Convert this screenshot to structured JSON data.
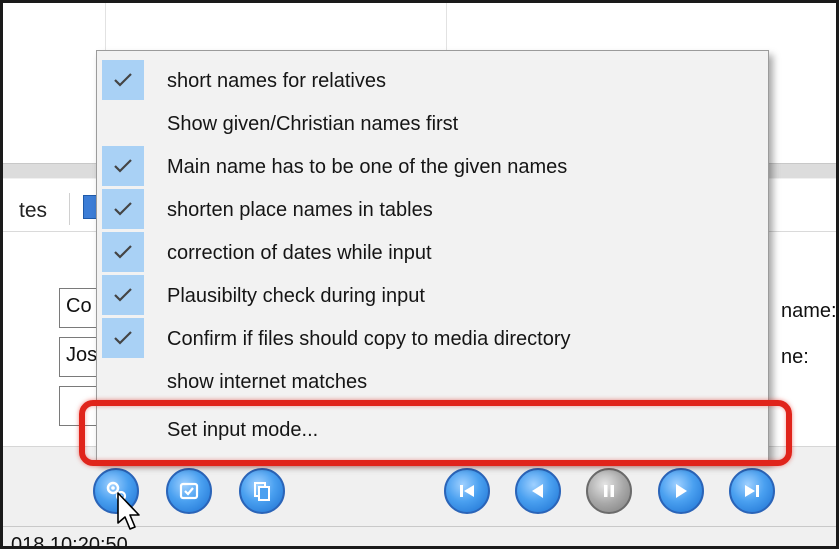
{
  "tab": {
    "label": "tes"
  },
  "form": {
    "field1": "Co",
    "field2": "Jos",
    "field3": "",
    "label1": "name:",
    "label2": "ne:"
  },
  "status": {
    "datetime": "018  10:20:50"
  },
  "menu": {
    "items": [
      {
        "label": "short names for relatives",
        "checked": true
      },
      {
        "label": "Show given/Christian names first",
        "checked": false
      },
      {
        "label": "Main name has to be one of the given names",
        "checked": true
      },
      {
        "label": "shorten place names in tables",
        "checked": true
      },
      {
        "label": "correction of dates while input",
        "checked": true
      },
      {
        "label": "Plausibilty check during input",
        "checked": true
      },
      {
        "label": "Confirm if files should copy to media directory",
        "checked": true
      },
      {
        "label": "show internet matches",
        "checked": false
      },
      {
        "label": "Set input mode...",
        "checked": false
      }
    ]
  },
  "toolbar": {
    "buttons": [
      {
        "icon": "settings-gears-icon"
      },
      {
        "icon": "checklist-icon"
      },
      {
        "icon": "copy-icon"
      },
      {
        "icon": "first-record-icon"
      },
      {
        "icon": "previous-record-icon"
      },
      {
        "icon": "pause-icon"
      },
      {
        "icon": "next-record-icon"
      },
      {
        "icon": "last-record-icon"
      }
    ]
  },
  "colors": {
    "highlight_ring": "#e0241b",
    "check_background": "#a9d1f5",
    "button_blue": "#4aa0f0"
  }
}
